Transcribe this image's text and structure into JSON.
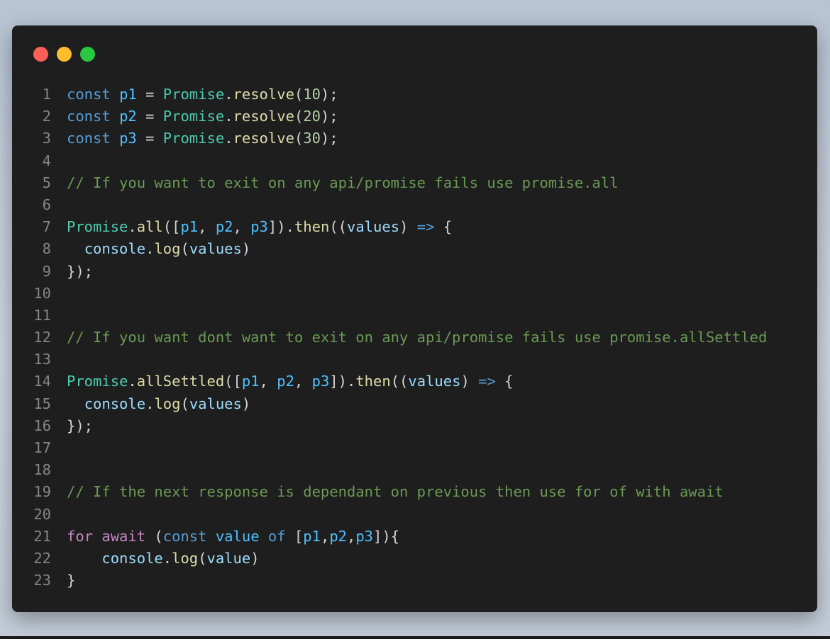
{
  "window": {
    "controls": {
      "close": "#ff5f57",
      "minimize": "#febc2e",
      "maximize": "#28c840"
    }
  },
  "code": {
    "line_numbers": [
      "1",
      "2",
      "3",
      "4",
      "5",
      "6",
      "7",
      "8",
      "9",
      "10",
      "11",
      "12",
      "13",
      "14",
      "15",
      "16",
      "17",
      "18",
      "19",
      "20",
      "21",
      "22",
      "23"
    ],
    "tokens": {
      "const": "const",
      "for": "for",
      "await": "await",
      "of": "of",
      "p1": "p1",
      "p2": "p2",
      "p3": "p3",
      "value": "value",
      "values": "values",
      "Promise": "Promise",
      "console": "console",
      "resolve": "resolve",
      "all": "all",
      "allSettled": "allSettled",
      "then": "then",
      "log": "log",
      "n10": "10",
      "n20": "20",
      "n30": "30",
      "eq": " = ",
      "dot": ".",
      "arrow": "=>"
    },
    "comments": {
      "c1": "// If you want to exit on any api/promise fails use promise.all",
      "c2": "// If you want dont want to exit on any api/promise fails use promise.allSettled",
      "c3": "// If the next response is dependant on previous then use for of with await"
    }
  }
}
